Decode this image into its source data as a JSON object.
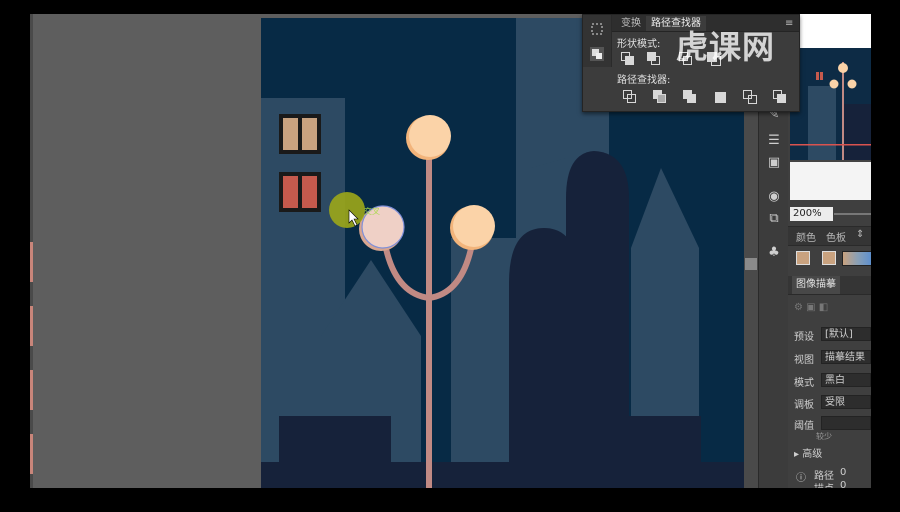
{
  "watermark": {
    "text": "虎课网"
  },
  "pathfinder": {
    "tabs": [
      "变换",
      "路径查找器"
    ],
    "shape_modes_label": "形状模式:",
    "pathfinders_label": "路径查找器:",
    "side_icons": [
      "selection-icon",
      "pathfinder-icon"
    ]
  },
  "navigator": {
    "zoom": "200%"
  },
  "color_panel": {
    "tabs": [
      "颜色",
      "色板"
    ]
  },
  "image_trace": {
    "title": "图像描摹",
    "rows": [
      {
        "label": "预设",
        "value": "[默认]"
      },
      {
        "label": "视图",
        "value": "描摹结果"
      },
      {
        "label": "模式",
        "value": "黑白"
      },
      {
        "label": "调板",
        "value": "受限"
      },
      {
        "label": "阈值",
        "value": ""
      }
    ],
    "threshold_hint": "较少",
    "advanced": "高级",
    "info": [
      {
        "label": "路径",
        "value": "0"
      },
      {
        "label": "描点",
        "value": "0"
      }
    ]
  },
  "colors": {
    "night_sky": "#072a45",
    "building_far": "#2d4a63",
    "building_near": "#16223a",
    "lamp_pole": "#c18a84",
    "lamp_globe": "#fbd3a8",
    "lamp_shade": "#f2b47b",
    "window_tan": "#c9a27f",
    "window_red": "#c65a4d",
    "cursor_highlight": "#9aa51a"
  }
}
